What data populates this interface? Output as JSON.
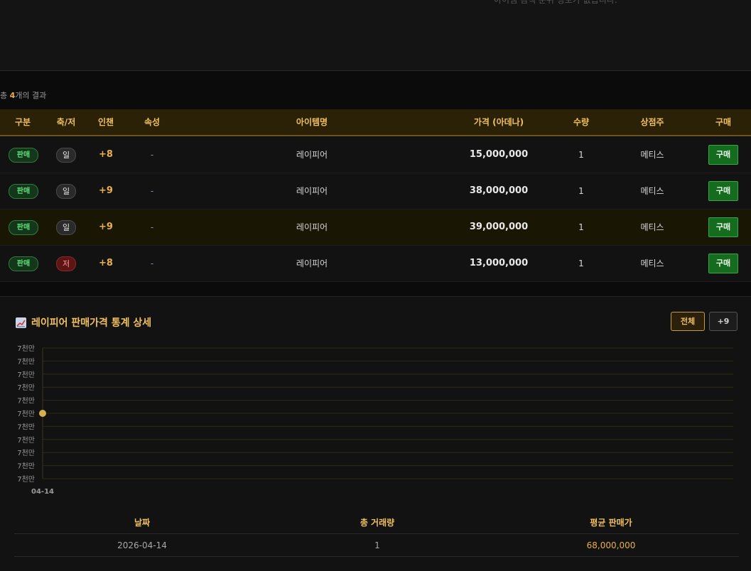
{
  "top_note": "아이템 검색 준위 정보가 없습니다.",
  "results": {
    "prefix": "총 ",
    "count": "4",
    "suffix": "개의 결과"
  },
  "table": {
    "headers": [
      "구분",
      "축/저",
      "인챈",
      "속성",
      "아이템명",
      "가격 (아데나)",
      "수량",
      "상점주",
      "구매"
    ],
    "rows": [
      {
        "type": "판매",
        "bless": "일",
        "enchant": "+8",
        "attribute": "-",
        "item": "레이피어",
        "price": "15,000,000",
        "qty": "1",
        "seller": "메티스",
        "buy": "구매",
        "highlight": false,
        "cursed": false
      },
      {
        "type": "판매",
        "bless": "일",
        "enchant": "+9",
        "attribute": "-",
        "item": "레이피어",
        "price": "38,000,000",
        "qty": "1",
        "seller": "메티스",
        "buy": "구매",
        "highlight": false,
        "cursed": false
      },
      {
        "type": "판매",
        "bless": "일",
        "enchant": "+9",
        "attribute": "-",
        "item": "레이피어",
        "price": "39,000,000",
        "qty": "1",
        "seller": "메티스",
        "buy": "구매",
        "highlight": true,
        "cursed": false
      },
      {
        "type": "판매",
        "bless": "저",
        "enchant": "+8",
        "attribute": "-",
        "item": "레이피어",
        "price": "13,000,000",
        "qty": "1",
        "seller": "메티스",
        "buy": "구매",
        "highlight": false,
        "cursed": true
      }
    ]
  },
  "stats": {
    "icon": "chart-increasing-icon",
    "title": "레이피어 판매가격 통계 상세",
    "filters": {
      "all": "전체",
      "plus9": "+9"
    },
    "table_headers": {
      "date": "날짜",
      "volume": "총 거래량",
      "avg": "평균 판매가"
    },
    "table_rows": [
      {
        "date": "2026-04-14",
        "volume": "1",
        "avg": "68,000,000"
      }
    ]
  },
  "chart_data": {
    "type": "line",
    "x": [
      "04-14"
    ],
    "series": [
      {
        "values": [
          68000000
        ]
      }
    ],
    "y_tick_labels": [
      "7천만",
      "7천만",
      "7천만",
      "7천만",
      "7천만",
      "7천만",
      "7천만",
      "7천만",
      "7천만",
      "7천만",
      "7천만"
    ],
    "ylim": [
      67500000,
      68500000
    ],
    "grid": true,
    "colors": {
      "point": "#d4b050",
      "grid": "#2e2a14"
    }
  }
}
